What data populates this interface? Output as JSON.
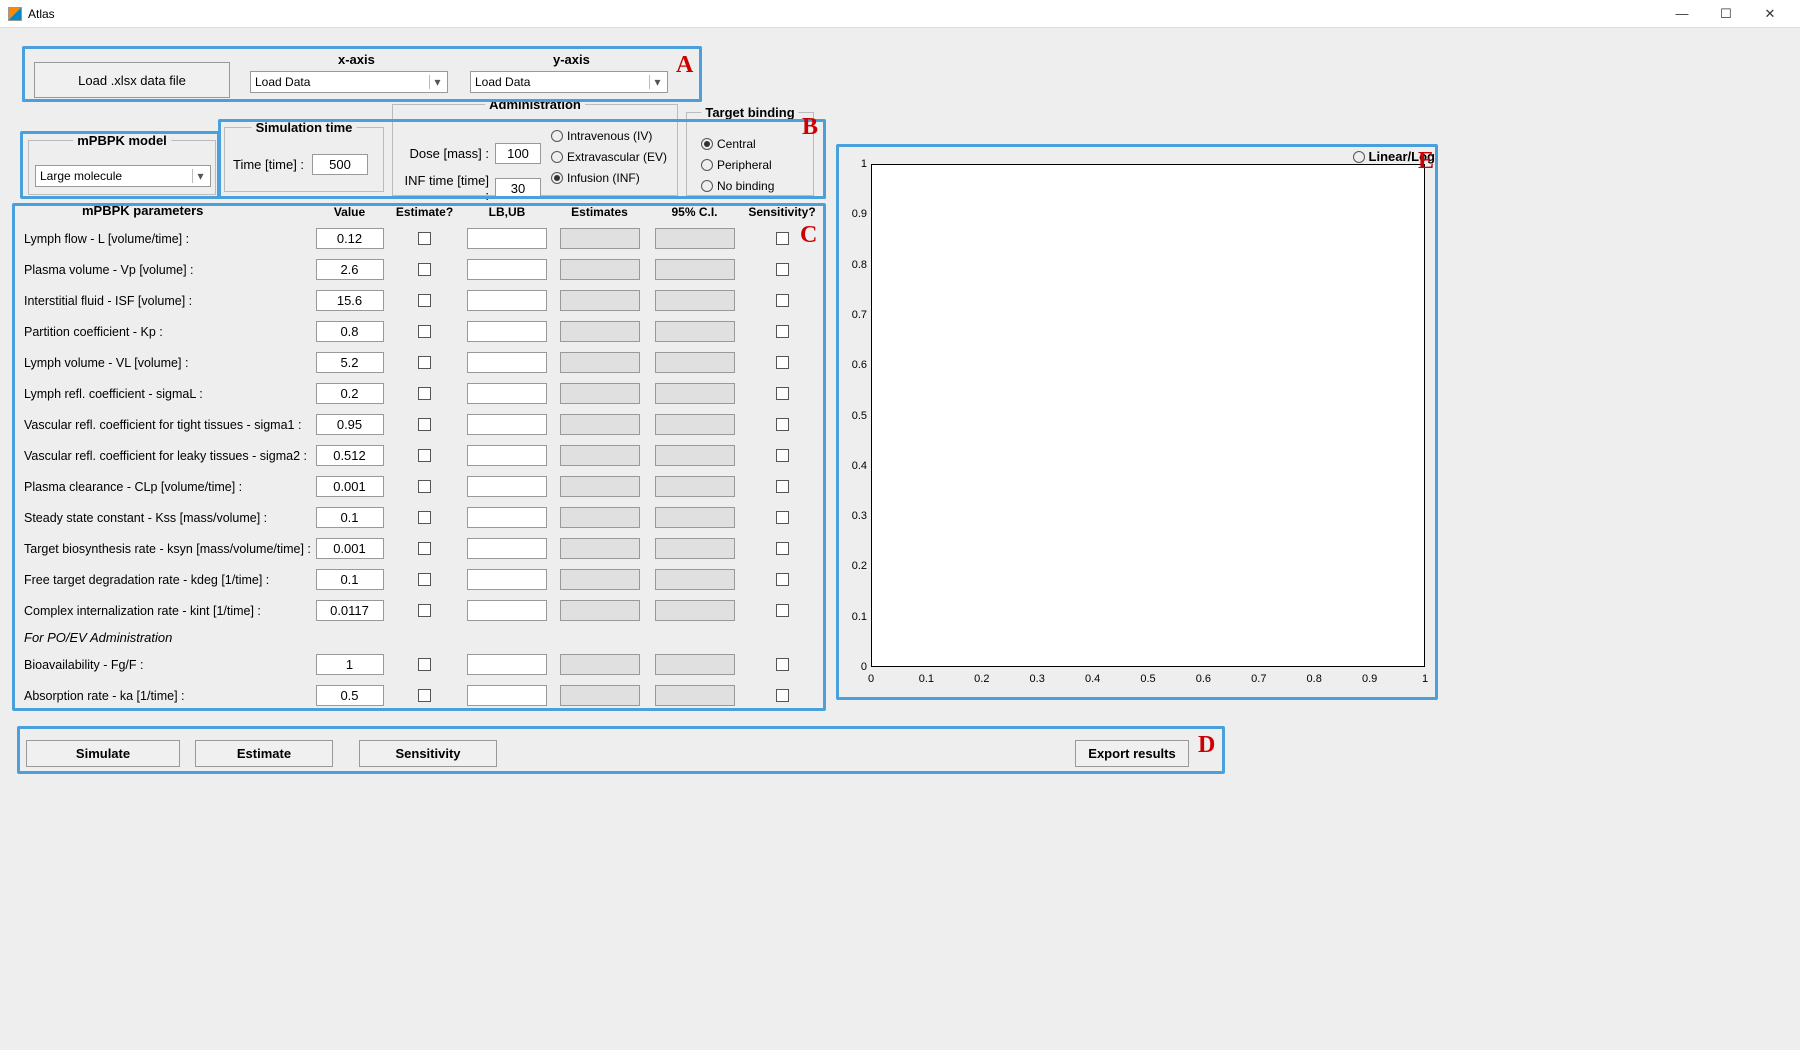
{
  "window": {
    "title": "Atlas"
  },
  "panelA": {
    "load_button": "Load .xlsx data file",
    "x_axis_label": "x-axis",
    "y_axis_label": "y-axis",
    "x_dd": "Load Data",
    "y_dd": "Load Data"
  },
  "model": {
    "group_title": "mPBPK model",
    "selected": "Large molecule"
  },
  "simtime": {
    "group_title": "Simulation time",
    "time_label": "Time [time] :",
    "time_value": "500"
  },
  "admin": {
    "group_title": "Administration",
    "dose_label": "Dose [mass] :",
    "dose_value": "100",
    "inf_label": "INF time [time] :",
    "inf_value": "30",
    "routes": {
      "iv": "Intravenous (IV)",
      "ev": "Extravascular (EV)",
      "inf": "Infusion (INF)"
    },
    "selected_route": "inf"
  },
  "target": {
    "group_title": "Target binding",
    "opts": {
      "central": "Central",
      "peripheral": "Peripheral",
      "none": "No binding"
    },
    "selected": "central"
  },
  "params": {
    "title": "mPBPK parameters",
    "headers": {
      "value": "Value",
      "estimate": "Estimate?",
      "lbub": "LB,UB",
      "estimates": "Estimates",
      "ci": "95% C.I.",
      "sens": "Sensitivity?"
    },
    "rows": [
      {
        "label": "Lymph flow - L [volume/time] :",
        "value": "0.12"
      },
      {
        "label": "Plasma volume - Vp [volume] :",
        "value": "2.6"
      },
      {
        "label": "Interstitial fluid - ISF [volume] :",
        "value": "15.6"
      },
      {
        "label": "Partition coefficient - Kp :",
        "value": "0.8"
      },
      {
        "label": "Lymph volume - VL [volume] :",
        "value": "5.2"
      },
      {
        "label": "Lymph refl. coefficient - sigmaL :",
        "value": "0.2"
      },
      {
        "label": "Vascular refl. coefficient for tight tissues - sigma1 :",
        "value": "0.95"
      },
      {
        "label": "Vascular refl. coefficient for leaky tissues - sigma2 :",
        "value": "0.512"
      },
      {
        "label": "Plasma clearance - CLp [volume/time] :",
        "value": "0.001"
      },
      {
        "label": "Steady state constant - Kss [mass/volume] :",
        "value": "0.1"
      },
      {
        "label": "Target biosynthesis rate - ksyn [mass/volume/time] :",
        "value": "0.001"
      },
      {
        "label": "Free target degradation rate - kdeg [1/time] :",
        "value": "0.1"
      },
      {
        "label": "Complex internalization rate - kint [1/time] :",
        "value": "0.0117"
      }
    ],
    "subheader": "For PO/EV Administration",
    "rows2": [
      {
        "label": "Bioavailability - Fg/F :",
        "value": "1"
      },
      {
        "label": "Absorption rate - ka [1/time] :",
        "value": "0.5"
      }
    ]
  },
  "plot": {
    "linlog_label": "Linear/Log",
    "y_ticks": [
      "0",
      "0.1",
      "0.2",
      "0.3",
      "0.4",
      "0.5",
      "0.6",
      "0.7",
      "0.8",
      "0.9",
      "1"
    ],
    "x_ticks": [
      "0",
      "0.1",
      "0.2",
      "0.3",
      "0.4",
      "0.5",
      "0.6",
      "0.7",
      "0.8",
      "0.9",
      "1"
    ]
  },
  "actions": {
    "simulate": "Simulate",
    "estimate": "Estimate",
    "sensitivity": "Sensitivity",
    "export": "Export results"
  },
  "section_labels": {
    "A": "A",
    "B": "B",
    "C": "C",
    "D": "D",
    "E": "E"
  }
}
